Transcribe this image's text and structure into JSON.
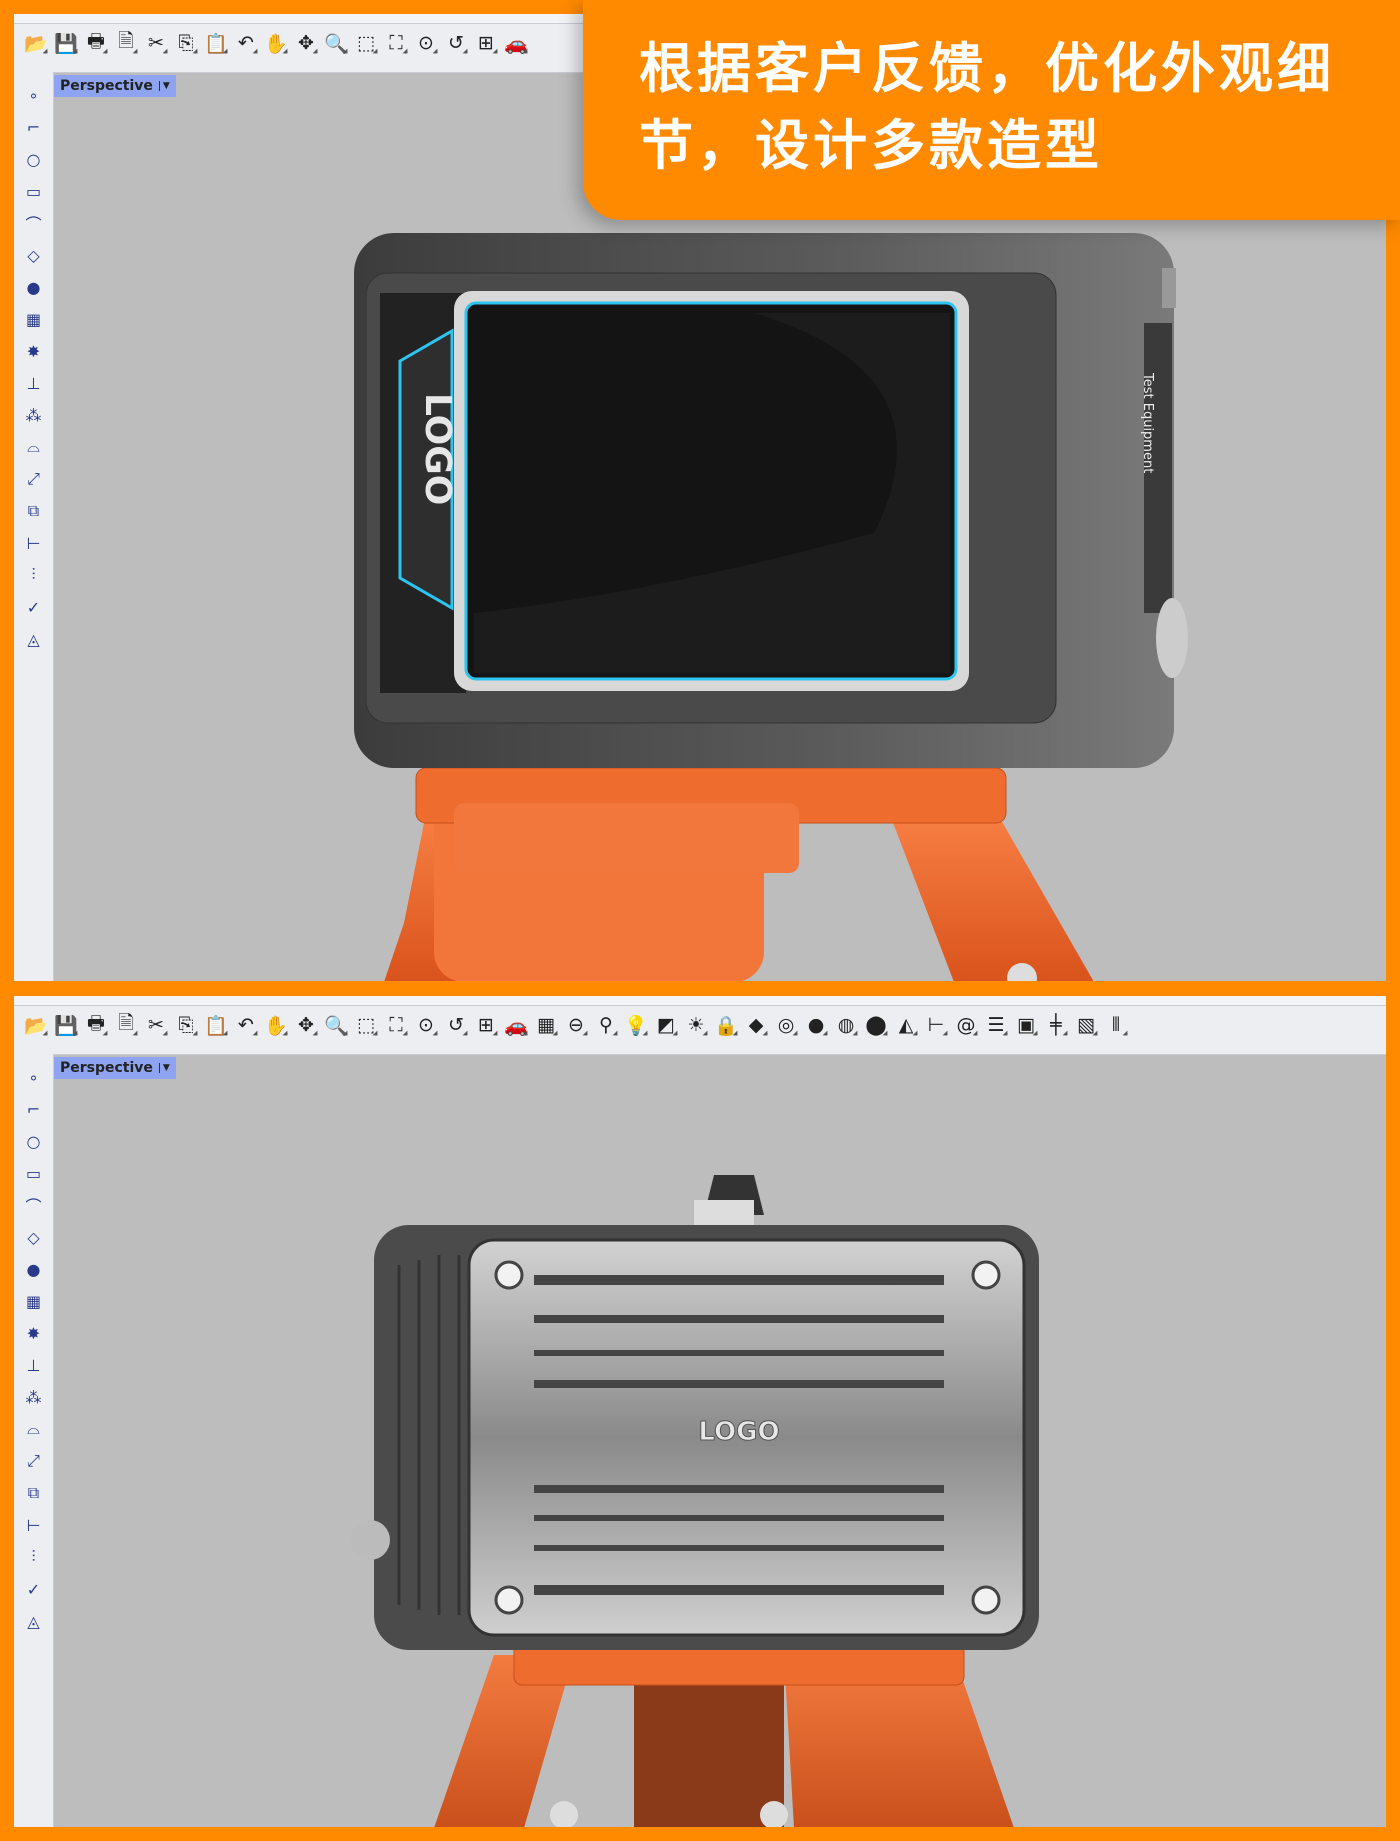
{
  "banner": {
    "text": "根据客户反馈，优化外观细节，设计多款造型"
  },
  "viewport": {
    "label": "Perspective"
  },
  "device": {
    "front_logo": "LOGO",
    "side_label": "Test Equipment",
    "back_logo": "LOGO"
  },
  "colors": {
    "frame": "#ff8a00",
    "viewport_bg": "#bdbdbd",
    "tab": "#8ea4f0",
    "tripod": "#f06a2a",
    "body": "#5a5a5a",
    "accent": "#2ec4f0"
  },
  "toolbar_top": [
    "open-icon",
    "save-icon",
    "print-icon",
    "import-icon",
    "cut-icon",
    "copy-icon",
    "paste-icon",
    "undo-icon",
    "pan-icon",
    "rotate-icon",
    "zoom-icon",
    "zoom-window-icon",
    "zoom-extents-icon",
    "zoom-selected-icon",
    "undo-view-icon",
    "viewport-layout-icon",
    "car-icon"
  ],
  "toolbar_bottom": [
    "open-icon",
    "save-icon",
    "print-icon",
    "import-icon",
    "cut-icon",
    "copy-icon",
    "paste-icon",
    "undo-icon",
    "pan-icon",
    "rotate-icon",
    "zoom-icon",
    "zoom-window-icon",
    "zoom-extents-icon",
    "zoom-selected-icon",
    "undo-view-icon",
    "viewport-layout-icon",
    "car-icon",
    "grid-icon",
    "cplane-icon",
    "gumball-icon",
    "light-icon",
    "light-toggle-icon",
    "lights-icon",
    "lock-icon",
    "shade-icon",
    "color-wheel-icon",
    "sphere-icon",
    "render-sphere-icon",
    "blue-sphere-icon",
    "spotlight-icon",
    "dimension-icon",
    "spiral-icon",
    "layers-icon",
    "box-icon",
    "section-icon",
    "hatch-icon",
    "mirror-icon"
  ],
  "toolbar_left": [
    "point-icon",
    "polyline-icon",
    "circle-icon",
    "rectangle-icon",
    "curve-icon",
    "surface-icon",
    "solid-icon",
    "mesh-icon",
    "explode-icon",
    "trim-icon",
    "group-icon",
    "fillet-icon",
    "transform-icon",
    "array-icon",
    "dimension-icon",
    "split-icon",
    "check-icon",
    "render-icon"
  ]
}
